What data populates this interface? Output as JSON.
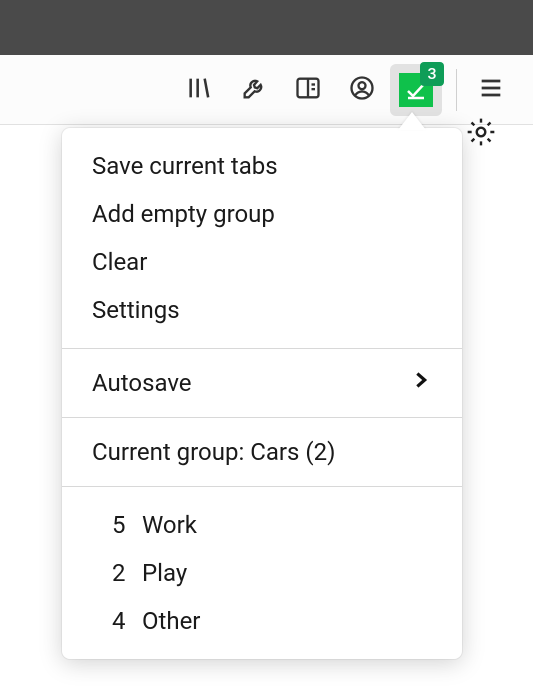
{
  "toolbar": {
    "badge_count": "3"
  },
  "popup": {
    "actions": {
      "save_tabs": "Save current tabs",
      "add_group": "Add empty group",
      "clear": "Clear",
      "settings": "Settings"
    },
    "autosave": "Autosave",
    "current_group_label": "Current group: Cars (2)",
    "groups": [
      {
        "count": "5",
        "name": "Work"
      },
      {
        "count": "2",
        "name": "Play"
      },
      {
        "count": "4",
        "name": "Other"
      }
    ]
  }
}
